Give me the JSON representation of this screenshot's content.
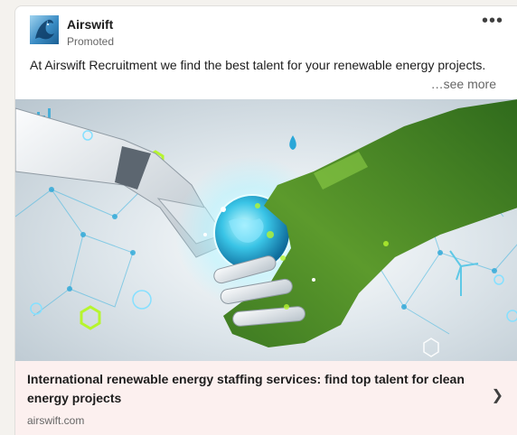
{
  "post": {
    "company": "Airswift",
    "promoted_label": "Promoted",
    "more_icon": "more-horizontal-icon",
    "commentary": "At Airswift Recruitment we find the best talent for your renewable energy projects.",
    "see_more": "…see more"
  },
  "image": {
    "description_icons": [
      "robot-hand",
      "grass-hand",
      "globe",
      "bicycle-icon",
      "solar-panel-icon",
      "wind-turbine-icon",
      "leaf-icon",
      "water-drop-icon",
      "hexagon-icons"
    ]
  },
  "link_card": {
    "headline": "International renewable energy staffing services: find top talent for clean energy projects",
    "domain": "airswift.com",
    "chevron": "❯"
  },
  "colors": {
    "footer_bg": "#fcf0ef",
    "grass_green": "#4f8a2a",
    "neon_green": "#b6f52e",
    "cyan_glow": "#38d6f0"
  }
}
